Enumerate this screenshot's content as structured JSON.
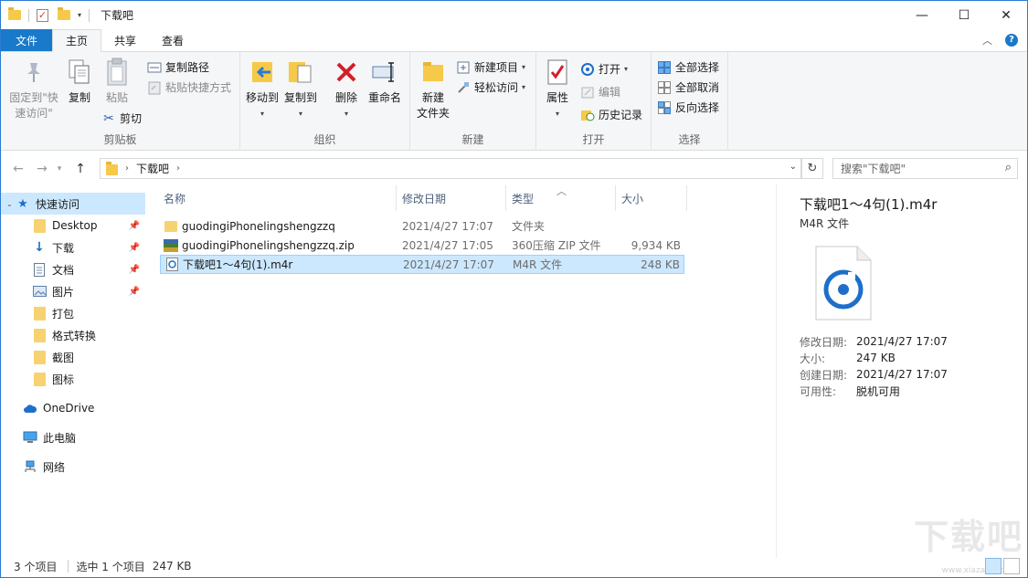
{
  "window": {
    "title": "下载吧",
    "min": "—",
    "max": "☐",
    "close": "✕"
  },
  "tabs": {
    "file": "文件",
    "home": "主页",
    "share": "共享",
    "view": "查看"
  },
  "ribbon": {
    "clipboard": {
      "label": "剪贴板",
      "pin_line1": "固定到\"快",
      "pin_line2": "速访问\"",
      "copy": "复制",
      "paste": "粘贴",
      "copy_path": "复制路径",
      "paste_shortcut": "粘贴快捷方式",
      "cut": "剪切"
    },
    "organize": {
      "label": "组织",
      "move_to": "移动到",
      "copy_to": "复制到",
      "delete": "删除",
      "rename": "重命名"
    },
    "new": {
      "label": "新建",
      "new_folder_line1": "新建",
      "new_folder_line2": "文件夹",
      "new_item": "新建项目",
      "easy_access": "轻松访问"
    },
    "open": {
      "label": "打开",
      "properties": "属性",
      "open": "打开",
      "edit": "编辑",
      "history": "历史记录"
    },
    "select": {
      "label": "选择",
      "select_all": "全部选择",
      "select_none": "全部取消",
      "invert": "反向选择"
    }
  },
  "address": {
    "path": "下载吧",
    "search_placeholder": "搜索\"下载吧\""
  },
  "nav": {
    "quick_access": "快速访问",
    "items": [
      {
        "label": "Desktop",
        "pinned": true
      },
      {
        "label": "下载",
        "pinned": true
      },
      {
        "label": "文档",
        "pinned": true
      },
      {
        "label": "图片",
        "pinned": true
      },
      {
        "label": "打包",
        "pinned": false
      },
      {
        "label": "格式转换",
        "pinned": false
      },
      {
        "label": "截图",
        "pinned": false
      },
      {
        "label": "图标",
        "pinned": false
      }
    ],
    "onedrive": "OneDrive",
    "this_pc": "此电脑",
    "network": "网络"
  },
  "filelist": {
    "columns": {
      "name": "名称",
      "date": "修改日期",
      "type": "类型",
      "size": "大小"
    },
    "rows": [
      {
        "name": "guodingiPhonelingshengzzq",
        "date": "2021/4/27 17:07",
        "type": "文件夹",
        "size": ""
      },
      {
        "name": "guodingiPhonelingshengzzq.zip",
        "date": "2021/4/27 17:05",
        "type": "360压缩 ZIP 文件",
        "size": "9,934 KB"
      },
      {
        "name": "下载吧1～4句(1).m4r",
        "date": "2021/4/27 17:07",
        "type": "M4R 文件",
        "size": "248 KB"
      }
    ]
  },
  "preview": {
    "title": "下载吧1～4句(1).m4r",
    "type": "M4R 文件",
    "props": [
      {
        "k": "修改日期:",
        "v": "2021/4/27 17:07"
      },
      {
        "k": "大小:",
        "v": "247 KB"
      },
      {
        "k": "创建日期:",
        "v": "2021/4/27 17:07"
      },
      {
        "k": "可用性:",
        "v": "脱机可用"
      }
    ]
  },
  "status": {
    "count": "3 个项目",
    "selected": "选中 1 个项目",
    "size": "247 KB"
  },
  "watermark": {
    "main": "下载吧",
    "sub": "www.xiazaiba.com"
  }
}
